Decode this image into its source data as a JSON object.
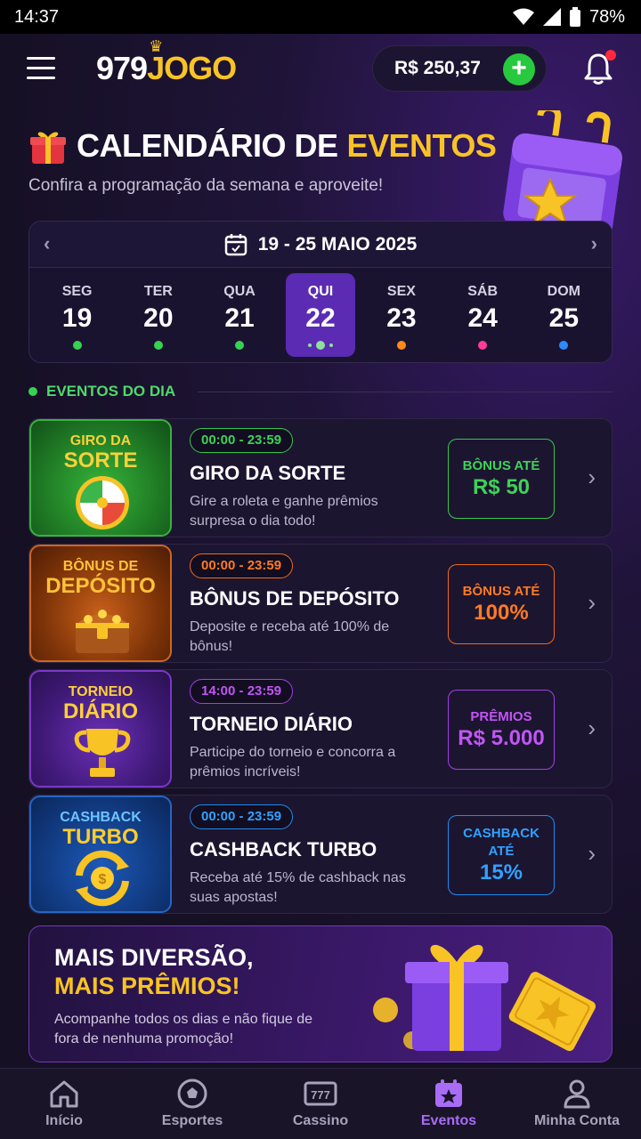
{
  "status_bar": {
    "time": "14:37",
    "battery": "78%"
  },
  "header": {
    "logo_number": "979",
    "logo_brand": "JOGO",
    "balance": "R$ 250,37"
  },
  "hero": {
    "title_main": "CALENDÁRIO DE",
    "title_accent": "EVENTOS",
    "subtitle": "Confira a programação da semana e aproveite!"
  },
  "calendar": {
    "range_label": "19 - 25 MAIO 2025",
    "days": [
      {
        "name": "SEG",
        "num": "19",
        "dot": "#37d152"
      },
      {
        "name": "TER",
        "num": "20",
        "dot": "#37d152"
      },
      {
        "name": "QUA",
        "num": "21",
        "dot": "#37d152"
      },
      {
        "name": "QUI",
        "num": "22",
        "dot": "#8ee09a"
      },
      {
        "name": "SEX",
        "num": "23",
        "dot": "#ff8a1a"
      },
      {
        "name": "SÁB",
        "num": "24",
        "dot": "#ff3d95"
      },
      {
        "name": "DOM",
        "num": "25",
        "dot": "#2a8cff"
      }
    ]
  },
  "section": {
    "label": "EVENTOS DO DIA"
  },
  "events": [
    {
      "thumb_top": "GIRO DA",
      "thumb_bottom": "SORTE",
      "time": "00:00 - 23:59",
      "title": "GIRO DA SORTE",
      "desc": "Gire a roleta e ganhe prêmios surpresa o dia todo!",
      "bonus_label": "BÔNUS ATÉ",
      "bonus_value": "R$ 50"
    },
    {
      "thumb_top": "BÔNUS DE",
      "thumb_bottom": "DEPÓSITO",
      "time": "00:00 - 23:59",
      "title": "BÔNUS DE DEPÓSITO",
      "desc": "Deposite e receba até 100% de bônus!",
      "bonus_label": "BÔNUS ATÉ",
      "bonus_value": "100%"
    },
    {
      "thumb_top": "TORNEIO",
      "thumb_bottom": "DIÁRIO",
      "time": "14:00 - 23:59",
      "title": "TORNEIO DIÁRIO",
      "desc": "Participe do torneio e concorra a prêmios incríveis!",
      "bonus_label": "PRÊMIOS",
      "bonus_value": "R$ 5.000"
    },
    {
      "thumb_top": "CASHBACK",
      "thumb_bottom": "TURBO",
      "time": "00:00 - 23:59",
      "title": "CASHBACK TURBO",
      "desc": "Receba até 15% de cashback nas suas apostas!",
      "bonus_label": "CASHBACK ATÉ",
      "bonus_value": "15%"
    }
  ],
  "promo": {
    "line1": "MAIS DIVERSÃO,",
    "line2": "MAIS PRÊMIOS!",
    "desc": "Acompanhe todos os dias e não fique de fora de nenhuma promoção!"
  },
  "bottom_nav": [
    {
      "label": "Início",
      "icon": "home-icon"
    },
    {
      "label": "Esportes",
      "icon": "soccer-ball-icon"
    },
    {
      "label": "Cassino",
      "icon": "slot-machine-icon"
    },
    {
      "label": "Eventos",
      "icon": "calendar-star-icon",
      "active": true
    },
    {
      "label": "Minha Conta",
      "icon": "user-icon"
    }
  ],
  "colors": {
    "accent_gold": "#f8c325",
    "active_purple": "#a86cf7",
    "success_green": "#27c93f"
  }
}
